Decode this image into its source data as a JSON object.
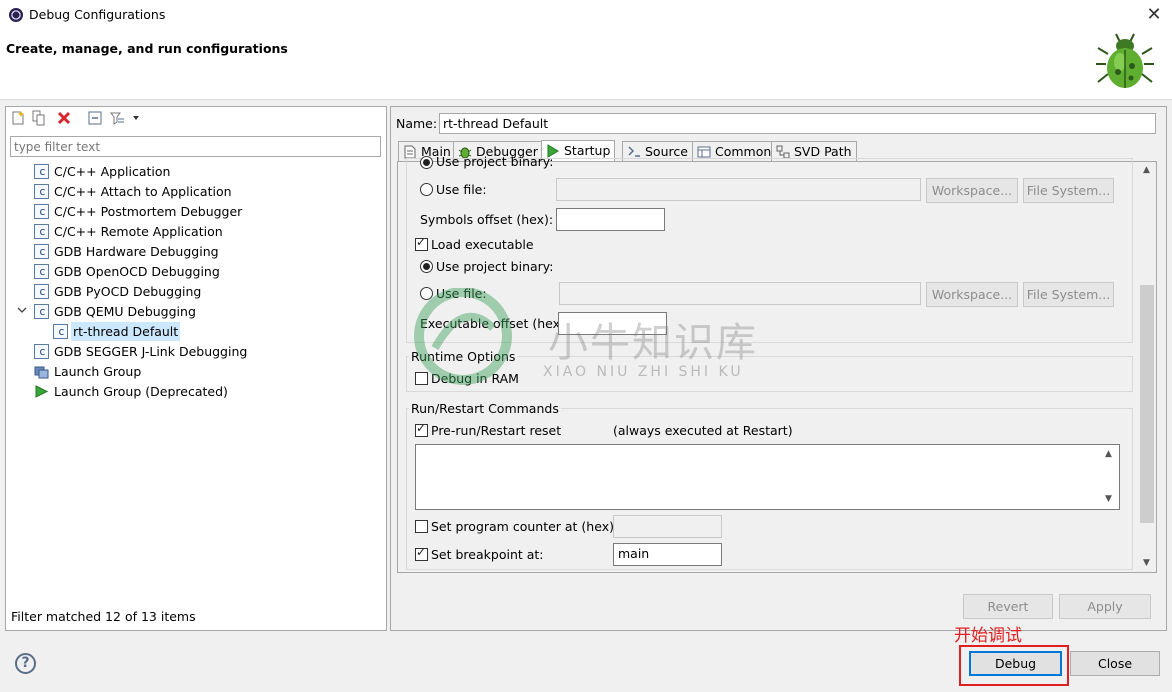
{
  "window": {
    "title": "Debug Configurations",
    "close_glyph": "✕"
  },
  "header": {
    "title": "Create, manage, and run configurations"
  },
  "left": {
    "filter_placeholder": "type filter text",
    "tree": [
      {
        "label": "C/C++ Application",
        "icon": "c-config-icon"
      },
      {
        "label": "C/C++ Attach to Application",
        "icon": "c-config-icon"
      },
      {
        "label": "C/C++ Postmortem Debugger",
        "icon": "c-config-icon"
      },
      {
        "label": "C/C++ Remote Application",
        "icon": "c-config-icon"
      },
      {
        "label": "GDB Hardware Debugging",
        "icon": "c-config-icon"
      },
      {
        "label": "GDB OpenOCD Debugging",
        "icon": "c-config-icon"
      },
      {
        "label": "GDB PyOCD Debugging",
        "icon": "c-config-icon"
      },
      {
        "label": "GDB QEMU Debugging",
        "icon": "c-config-icon",
        "expanded": true
      },
      {
        "label": "rt-thread Default",
        "icon": "c-config-icon",
        "selected": true
      },
      {
        "label": "GDB SEGGER J-Link Debugging",
        "icon": "c-config-icon"
      },
      {
        "label": "Launch Group",
        "icon": "launch-group-icon"
      },
      {
        "label": "Launch Group (Deprecated)",
        "icon": "launch-run-icon"
      }
    ],
    "status": "Filter matched 12 of 13 items"
  },
  "right": {
    "name_label": "Name:",
    "name_value": "rt-thread Default",
    "tabs": [
      {
        "label": "Main",
        "icon": "main-tab-icon"
      },
      {
        "label": "Debugger",
        "icon": "debugger-tab-icon"
      },
      {
        "label": "Startup",
        "icon": "startup-tab-icon",
        "active": true
      },
      {
        "label": "Source",
        "icon": "source-tab-icon"
      },
      {
        "label": "Common",
        "icon": "common-tab-icon"
      },
      {
        "label": "SVD Path",
        "icon": "svd-tab-icon"
      }
    ],
    "startup": {
      "use_project_binary_top": "Use project binary:",
      "use_file_1": "Use file:",
      "workspace_1": "Workspace...",
      "filesystem_1": "File System...",
      "symbols_offset": "Symbols offset (hex):",
      "load_executable": "Load executable",
      "use_project_binary": "Use project binary:",
      "use_file_2": "Use file:",
      "workspace_2": "Workspace...",
      "filesystem_2": "File System...",
      "exec_offset": "Executable offset (hex):",
      "runtime_options_title": "Runtime Options",
      "debug_in_ram": "Debug in RAM",
      "run_restart_title": "Run/Restart Commands",
      "pre_run_reset": "Pre-run/Restart reset",
      "always_executed": "(always executed at Restart)",
      "set_pc": "Set program counter at (hex):",
      "set_breakpoint": "Set breakpoint at:",
      "breakpoint_value": "main"
    },
    "revert": "Revert",
    "apply": "Apply"
  },
  "footer": {
    "help": "?",
    "annotation": "开始调试",
    "debug": "Debug",
    "close": "Close"
  },
  "watermark": {
    "cn": "小牛知识库",
    "en": "XIAO NIU ZHI SHI KU"
  },
  "colors": {
    "selection": "#cce8ff",
    "annotation_red": "#e02020"
  }
}
